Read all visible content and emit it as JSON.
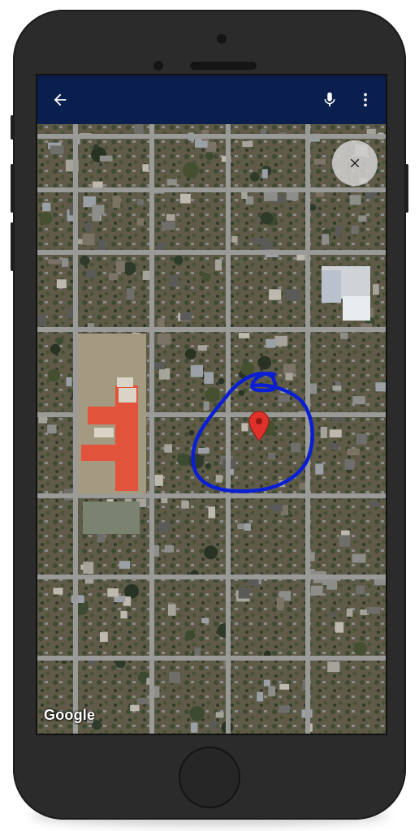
{
  "appbar": {
    "back_icon": "back-arrow-icon",
    "mic_icon": "microphone-icon",
    "more_icon": "more-vert-icon",
    "background_color": "#0b1f4e"
  },
  "map": {
    "type": "satellite",
    "attribution": "Google",
    "close_icon": "close-icon",
    "marker_icon": "location-pin-icon",
    "marker_color": "#e0312a",
    "annotation_color": "#0a1fd4"
  }
}
